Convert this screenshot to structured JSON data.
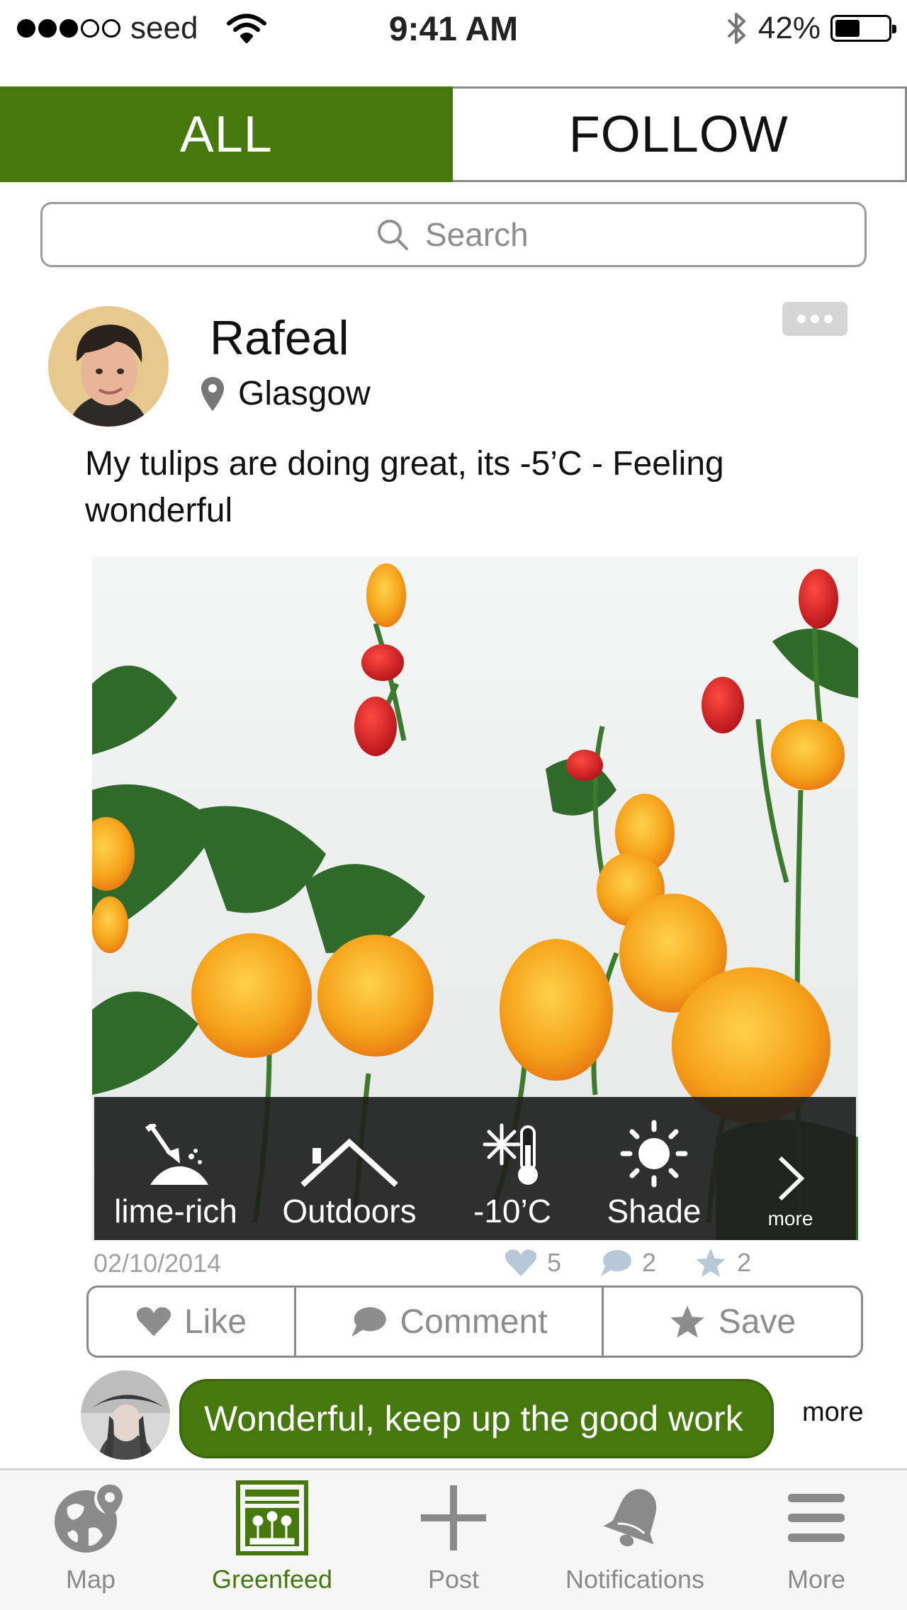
{
  "status_bar": {
    "carrier": "seed",
    "time": "9:41 AM",
    "battery": "42%",
    "battery_level": 0.42,
    "signal_bars": 3,
    "signal_total": 5
  },
  "segment": {
    "all_label": "ALL",
    "follow_label": "FOLLOW",
    "selected": "ALL"
  },
  "search": {
    "placeholder": "Search",
    "value": ""
  },
  "post": {
    "username": "Rafeal",
    "location": "Glasgow",
    "text": "My tulips are doing great, its -5’C - Feeling wonderful",
    "date": "02/10/2014",
    "likes": "5",
    "comments": "2",
    "saves": "2",
    "attributes": [
      {
        "icon": "soil-shovel-icon",
        "label": "lime-rich"
      },
      {
        "icon": "outdoors-roof-icon",
        "label": "Outdoors"
      },
      {
        "icon": "frost-thermometer-icon",
        "label": "-10’C"
      },
      {
        "icon": "sun-icon",
        "label": "Shade"
      }
    ],
    "attributes_more": "more"
  },
  "actions": {
    "like": "Like",
    "comment": "Comment",
    "save": "Save"
  },
  "comment": {
    "text": "Wonderful, keep up the good work",
    "more": "more"
  },
  "tabbar": {
    "items": [
      {
        "label": "Map",
        "icon": "globe-pin-icon"
      },
      {
        "label": "Greenfeed",
        "icon": "greenfeed-icon",
        "active": true
      },
      {
        "label": "Post",
        "icon": "plus-icon"
      },
      {
        "label": "Notifications",
        "icon": "bell-icon"
      },
      {
        "label": "More",
        "icon": "menu-icon"
      }
    ]
  },
  "colors": {
    "accent_green": "#46780d",
    "muted_gray": "#8d8d8d",
    "icon_blue_gray": "#b9c8d6"
  }
}
